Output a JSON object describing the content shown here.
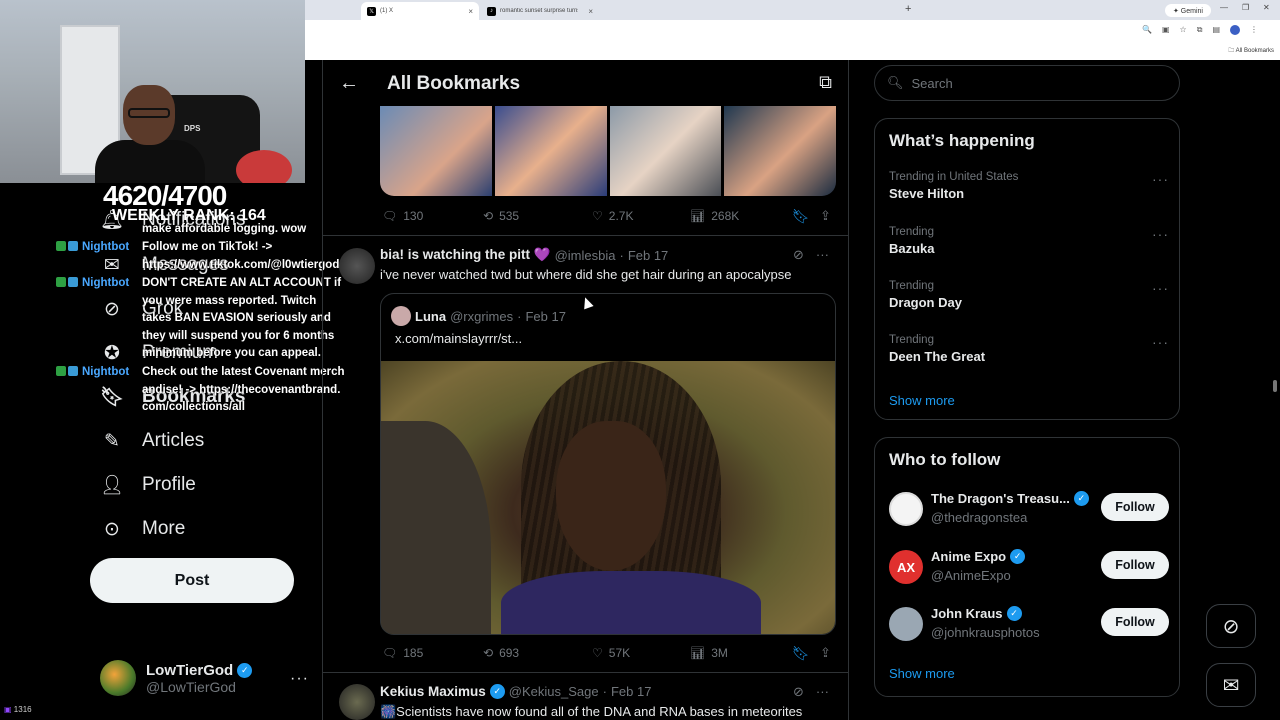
{
  "browser": {
    "tabs": [
      {
        "title": "(1) X",
        "favicon": "x-logo-icon",
        "active": true
      },
      {
        "title": "romantic sunset surprise turns...",
        "favicon": "tiktok-icon",
        "active": false
      }
    ],
    "gemini_label": "✦ Gemini",
    "bookmarks_label": "All Bookmarks"
  },
  "stream": {
    "counter": "4620/4700",
    "weekly_rank": "WEEKLY RANK: 164",
    "viewers": "1316",
    "chat": [
      {
        "nick": "",
        "text": "make affordable logging. wow"
      },
      {
        "nick": "Nightbot",
        "text": "Follow me on TikTok! -> https://www.tiktok.com/@l0wtiergod"
      },
      {
        "nick": "Nightbot",
        "text": "DON'T CREATE AN ALT ACCOUNT if you were mass reported. Twitch takes BAN EVASION seriously and they will suspend you for 6 months minimum before you can appeal."
      },
      {
        "nick": "Nightbot",
        "text": "Check out the latest Covenant merchandise! -> https://thecovenantbrand.com/collections/all"
      }
    ]
  },
  "nav": {
    "items": [
      {
        "label": "Notifications",
        "icon": "bell-icon"
      },
      {
        "label": "Messages",
        "icon": "envelope-icon"
      },
      {
        "label": "Grok",
        "icon": "grok-icon"
      },
      {
        "label": "Premium",
        "icon": "verified-badge-icon"
      },
      {
        "label": "Bookmarks",
        "icon": "bookmark-icon"
      },
      {
        "label": "Articles",
        "icon": "article-icon"
      },
      {
        "label": "Profile",
        "icon": "person-icon"
      },
      {
        "label": "More",
        "icon": "more-circle-icon"
      }
    ],
    "post_label": "Post",
    "account": {
      "name": "LowTierGod",
      "handle": "@LowTierGod"
    }
  },
  "main": {
    "title": "All Bookmarks",
    "tweets": [
      {
        "stats": {
          "replies": "130",
          "reposts": "535",
          "likes": "2.7K",
          "views": "268K"
        }
      },
      {
        "name": "bia! is watching the pitt 💜",
        "handle": "@imlesbia",
        "date": "Feb 17",
        "text": "i've never watched twd but where did she get hair during an apocalypse",
        "quote": {
          "name": "Luna",
          "handle": "@rxgrimes",
          "date": "Feb 17",
          "text": "x.com/mainslayrrr/st..."
        },
        "stats": {
          "replies": "185",
          "reposts": "693",
          "likes": "57K",
          "views": "3M"
        }
      },
      {
        "name": "Kekius Maximus",
        "handle": "@Kekius_Sage",
        "date": "Feb 17",
        "text": "🎆Scientists have now found all of the DNA and RNA bases in meteorites"
      }
    ]
  },
  "sidebar": {
    "search_placeholder": "Search",
    "whats_happening_title": "What’s happening",
    "trends": [
      {
        "context": "Trending in United States",
        "name": "Steve Hilton"
      },
      {
        "context": "Trending",
        "name": "Bazuka"
      },
      {
        "context": "Trending",
        "name": "Dragon Day"
      },
      {
        "context": "Trending",
        "name": "Deen The Great"
      }
    ],
    "show_more": "Show more",
    "who_to_follow_title": "Who to follow",
    "follow_suggestions": [
      {
        "name": "The Dragon's Treasu...",
        "handle": "@thedragonstea",
        "avatar_color": "#f4f4f4"
      },
      {
        "name": "Anime Expo",
        "handle": "@AnimeExpo",
        "avatar_color": "#e0302e"
      },
      {
        "name": "John Kraus",
        "handle": "@johnkrausphotos",
        "avatar_color": "#9aa7b3"
      }
    ],
    "follow_label": "Follow",
    "show_more_2": "Show more"
  }
}
